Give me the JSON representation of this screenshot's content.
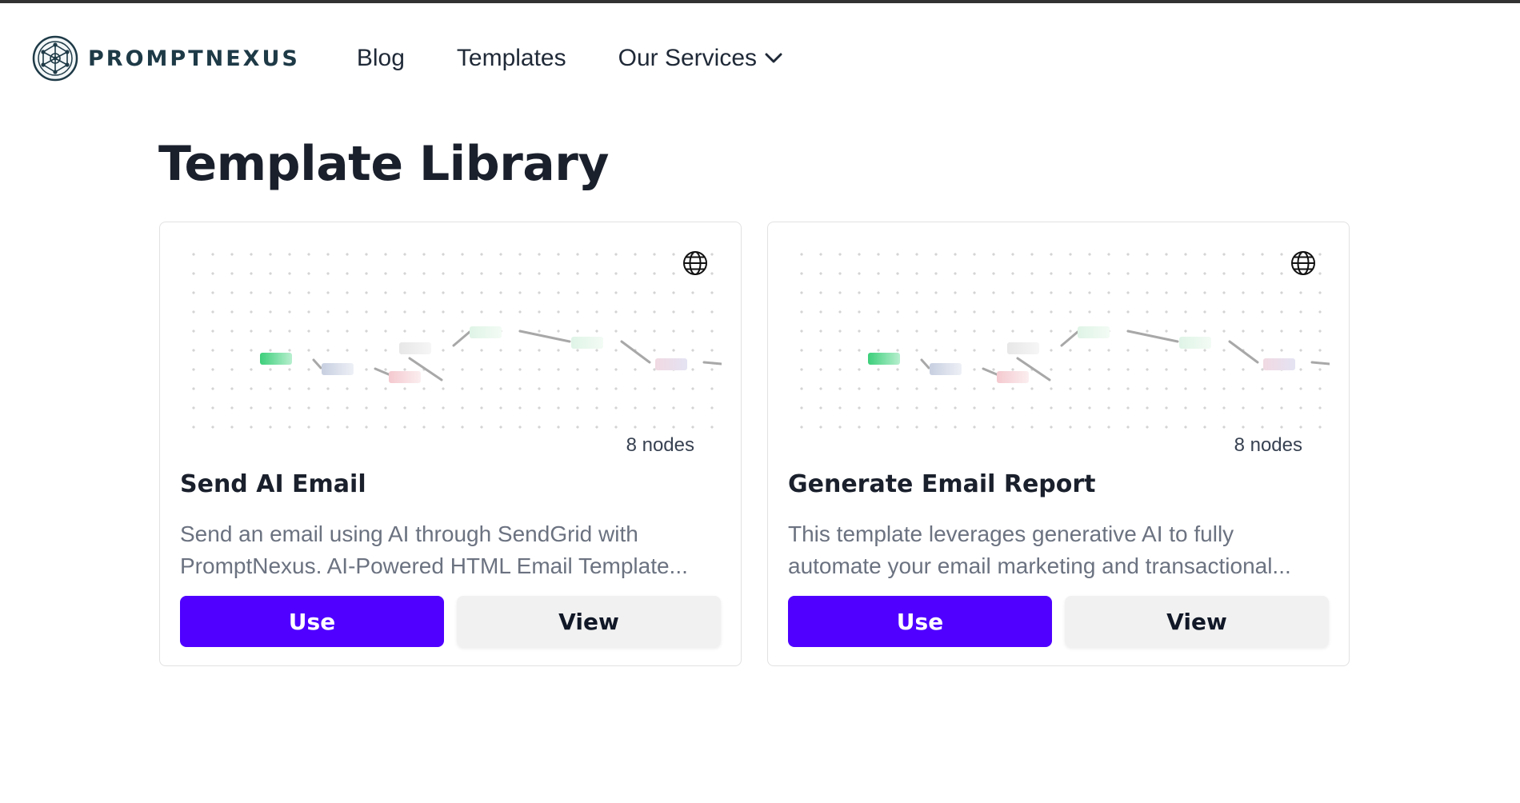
{
  "brand": {
    "name": "PROMPTNEXUS"
  },
  "nav": {
    "blog": "Blog",
    "templates": "Templates",
    "services": "Our Services"
  },
  "page": {
    "title": "Template Library"
  },
  "cards": [
    {
      "title": "Send AI Email",
      "desc_line1": "Send an email using AI through SendGrid with",
      "desc_line2": "PromptNexus. AI-Powered HTML Email Template...",
      "node_count": "8 nodes",
      "use_label": "Use",
      "view_label": "View"
    },
    {
      "title": "Generate Email Report",
      "desc_line1": "This template leverages generative AI to fully",
      "desc_line2": "automate your email marketing and transactional...",
      "node_count": "8 nodes",
      "use_label": "Use",
      "view_label": "View"
    }
  ],
  "colors": {
    "accent": "#4f00ff",
    "view_button_bg": "#f1f1f1",
    "brand_text": "#1e3a47"
  },
  "icons": [
    "promptnexus-logo-icon",
    "chevron-down-icon",
    "globe-icon"
  ]
}
